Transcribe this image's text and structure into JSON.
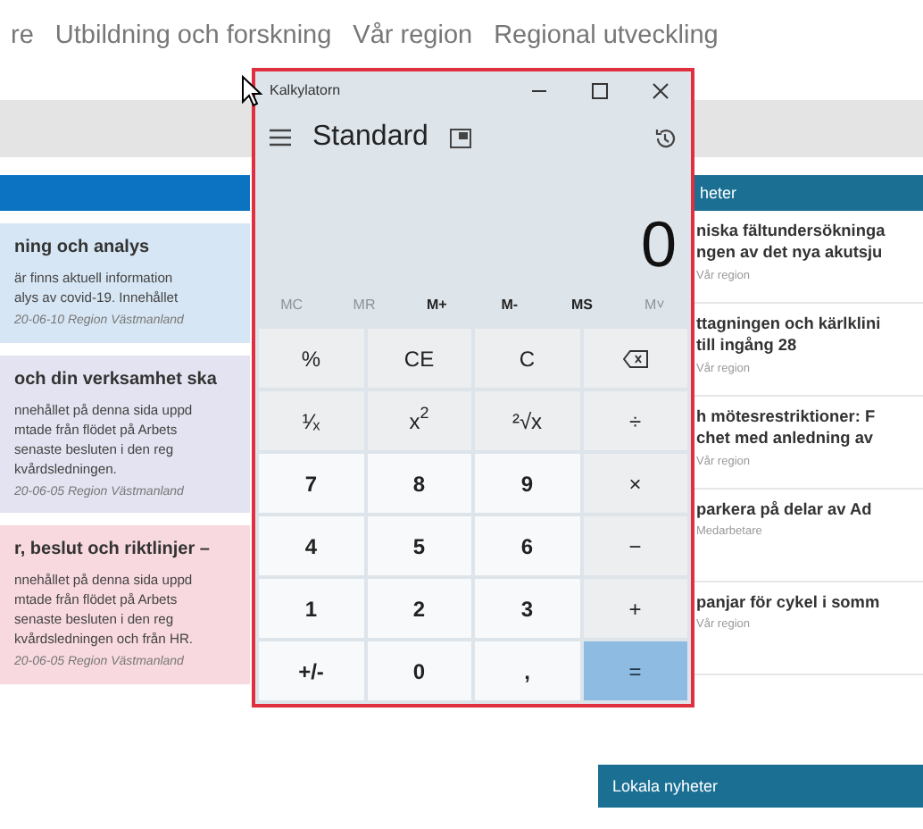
{
  "nav": {
    "links": [
      "re",
      "Utbildning och forskning",
      "Vår region",
      "Regional utveckling"
    ]
  },
  "left_cards": [
    {
      "color": "#d7e6f4",
      "title": "ning och analys",
      "body": "är finns aktuell information\nalys av covid-19. Innehållet",
      "meta": "20-06-10 Region Västmanland"
    },
    {
      "color": "#e3e3f1",
      "title": "och din verksamhet ska",
      "body": "nnehållet på denna sida uppd\nmtade från flödet på Arbets\nsenaste besluten i den reg\nkvårdsledningen.",
      "meta": "20-06-05 Region Västmanland"
    },
    {
      "color": "#f8d9df",
      "title": "r, beslut och riktlinjer –",
      "body": "nnehållet på denna sida uppd\nmtade från flödet på Arbets\nsenaste besluten i den reg\nkvårdsledningen och från HR.",
      "meta": "20-06-05 Region Västmanland"
    }
  ],
  "news": {
    "heading": "heter",
    "items": [
      {
        "title": "niska fältundersökninga\nngen av det nya akutsju",
        "meta": "Vår region"
      },
      {
        "title": "ttagningen och kärlklini\ntill ingång 28",
        "meta": "Vår region"
      },
      {
        "title": "h mötesrestriktioner: F\nchet med anledning av",
        "meta": "Vår region"
      },
      {
        "title": "parkera på delar av Ad",
        "meta": "Medarbetare"
      },
      {
        "title": "panjar för cykel i somm",
        "meta": "Vår region"
      }
    ]
  },
  "local_news": {
    "heading": "Lokala nyheter"
  },
  "calculator": {
    "title": "Kalkylatorn",
    "mode": "Standard",
    "display": "0",
    "memory": [
      {
        "label": "MC",
        "disabled": true
      },
      {
        "label": "MR",
        "disabled": true
      },
      {
        "label": "M+",
        "disabled": false
      },
      {
        "label": "M-",
        "disabled": false
      },
      {
        "label": "MS",
        "disabled": false
      },
      {
        "label": "M˅",
        "disabled": true
      }
    ],
    "keys": [
      {
        "label": "%",
        "kind": "op"
      },
      {
        "label": "CE",
        "kind": "op"
      },
      {
        "label": "C",
        "kind": "op"
      },
      {
        "kind": "backspace"
      },
      {
        "label": "¹⁄ₓ",
        "kind": "op"
      },
      {
        "label": "x$^{2}$",
        "kind": "op"
      },
      {
        "label": "²√x",
        "kind": "op"
      },
      {
        "label": "÷",
        "kind": "op"
      },
      {
        "label": "7",
        "kind": "digit"
      },
      {
        "label": "8",
        "kind": "digit"
      },
      {
        "label": "9",
        "kind": "digit"
      },
      {
        "label": "×",
        "kind": "op"
      },
      {
        "label": "4",
        "kind": "digit"
      },
      {
        "label": "5",
        "kind": "digit"
      },
      {
        "label": "6",
        "kind": "digit"
      },
      {
        "label": "−",
        "kind": "op"
      },
      {
        "label": "1",
        "kind": "digit"
      },
      {
        "label": "2",
        "kind": "digit"
      },
      {
        "label": "3",
        "kind": "digit"
      },
      {
        "label": "+",
        "kind": "op"
      },
      {
        "label": "+/-",
        "kind": "digit"
      },
      {
        "label": "0",
        "kind": "digit"
      },
      {
        "label": ",",
        "kind": "digit"
      },
      {
        "label": "=",
        "kind": "equals"
      }
    ]
  }
}
